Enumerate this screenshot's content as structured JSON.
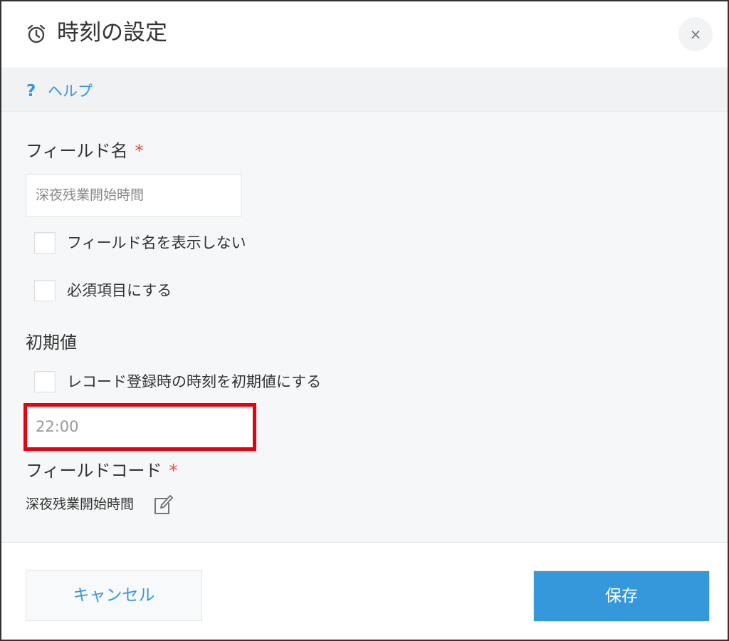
{
  "dialog": {
    "title": "時刻の設定",
    "close_label": "×",
    "header_icon": "alarm-clock-icon"
  },
  "help": {
    "icon": "question-mark-icon",
    "icon_glyph": "?",
    "label": "ヘルプ"
  },
  "field_name": {
    "label": "フィールド名",
    "required_mark": "*",
    "value": "深夜残業開始時間",
    "hide_label_checkbox": "フィールド名を表示しない",
    "required_checkbox": "必須項目にする"
  },
  "default_value": {
    "label": "初期値",
    "use_record_time_checkbox": "レコード登録時の時刻を初期値にする",
    "value": "22:00"
  },
  "field_code": {
    "label": "フィールドコード",
    "required_mark": "*",
    "value": "深夜残業開始時間",
    "edit_icon": "edit-pencil-icon"
  },
  "footer": {
    "cancel_label": "キャンセル",
    "save_label": "保存"
  },
  "colors": {
    "accent": "#3498db",
    "required": "#e74c3c",
    "highlight": "#e60012"
  }
}
